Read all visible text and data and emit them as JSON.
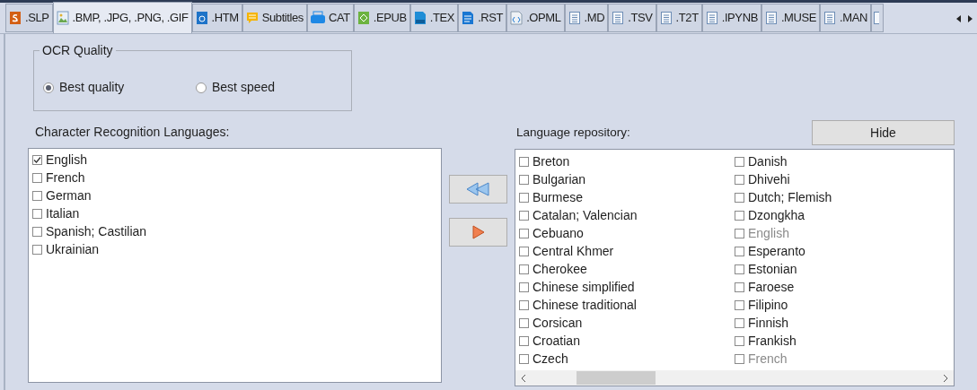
{
  "tabs": [
    {
      "label": ".SLP",
      "kind": "slp",
      "selected": false
    },
    {
      "label": ".BMP, .JPG, .PNG, .GIF",
      "kind": "image",
      "selected": true
    },
    {
      "label": ".HTM",
      "kind": "htm",
      "selected": false
    },
    {
      "label": "Subtitles",
      "kind": "subtitles",
      "selected": false
    },
    {
      "label": "CAT",
      "kind": "cat",
      "selected": false
    },
    {
      "label": ".EPUB",
      "kind": "epub",
      "selected": false
    },
    {
      "label": ".TEX",
      "kind": "tex",
      "selected": false
    },
    {
      "label": ".RST",
      "kind": "rst",
      "selected": false
    },
    {
      "label": ".OPML",
      "kind": "opml",
      "selected": false
    },
    {
      "label": ".MD",
      "kind": "doc",
      "selected": false
    },
    {
      "label": ".TSV",
      "kind": "doc",
      "selected": false
    },
    {
      "label": ".T2T",
      "kind": "doc",
      "selected": false
    },
    {
      "label": ".IPYNB",
      "kind": "doc",
      "selected": false
    },
    {
      "label": ".MUSE",
      "kind": "doc",
      "selected": false
    },
    {
      "label": ".MAN",
      "kind": "doc",
      "selected": false
    }
  ],
  "ocr_quality": {
    "title": "OCR Quality",
    "options": [
      {
        "label": "Best quality",
        "selected": true
      },
      {
        "label": "Best speed",
        "selected": false
      }
    ]
  },
  "recognition_languages": {
    "title": "Character Recognition Languages:",
    "items": [
      {
        "label": "English",
        "checked": true
      },
      {
        "label": "French",
        "checked": false
      },
      {
        "label": "German",
        "checked": false
      },
      {
        "label": "Italian",
        "checked": false
      },
      {
        "label": "Spanish; Castilian",
        "checked": false
      },
      {
        "label": "Ukrainian",
        "checked": false
      }
    ]
  },
  "repository": {
    "title": "Language repository:",
    "hide_button": "Hide",
    "columns": [
      [
        {
          "label": "Breton",
          "checked": false,
          "disabled": false
        },
        {
          "label": "Bulgarian",
          "checked": false,
          "disabled": false
        },
        {
          "label": "Burmese",
          "checked": false,
          "disabled": false
        },
        {
          "label": "Catalan; Valencian",
          "checked": false,
          "disabled": false
        },
        {
          "label": "Cebuano",
          "checked": false,
          "disabled": false
        },
        {
          "label": "Central Khmer",
          "checked": false,
          "disabled": false
        },
        {
          "label": "Cherokee",
          "checked": false,
          "disabled": false
        },
        {
          "label": "Chinese simplified",
          "checked": false,
          "disabled": false
        },
        {
          "label": "Chinese traditional",
          "checked": false,
          "disabled": false
        },
        {
          "label": "Corsican",
          "checked": false,
          "disabled": false
        },
        {
          "label": "Croatian",
          "checked": false,
          "disabled": false
        },
        {
          "label": "Czech",
          "checked": false,
          "disabled": false
        }
      ],
      [
        {
          "label": "Danish",
          "checked": false,
          "disabled": false
        },
        {
          "label": "Dhivehi",
          "checked": false,
          "disabled": false
        },
        {
          "label": "Dutch; Flemish",
          "checked": false,
          "disabled": false
        },
        {
          "label": "Dzongkha",
          "checked": false,
          "disabled": false
        },
        {
          "label": "English",
          "checked": false,
          "disabled": true
        },
        {
          "label": "Esperanto",
          "checked": false,
          "disabled": false
        },
        {
          "label": "Estonian",
          "checked": false,
          "disabled": false
        },
        {
          "label": "Faroese",
          "checked": false,
          "disabled": false
        },
        {
          "label": "Filipino",
          "checked": false,
          "disabled": false
        },
        {
          "label": "Finnish",
          "checked": false,
          "disabled": false
        },
        {
          "label": "Frankish",
          "checked": false,
          "disabled": false
        },
        {
          "label": "French",
          "checked": false,
          "disabled": true
        }
      ]
    ]
  }
}
